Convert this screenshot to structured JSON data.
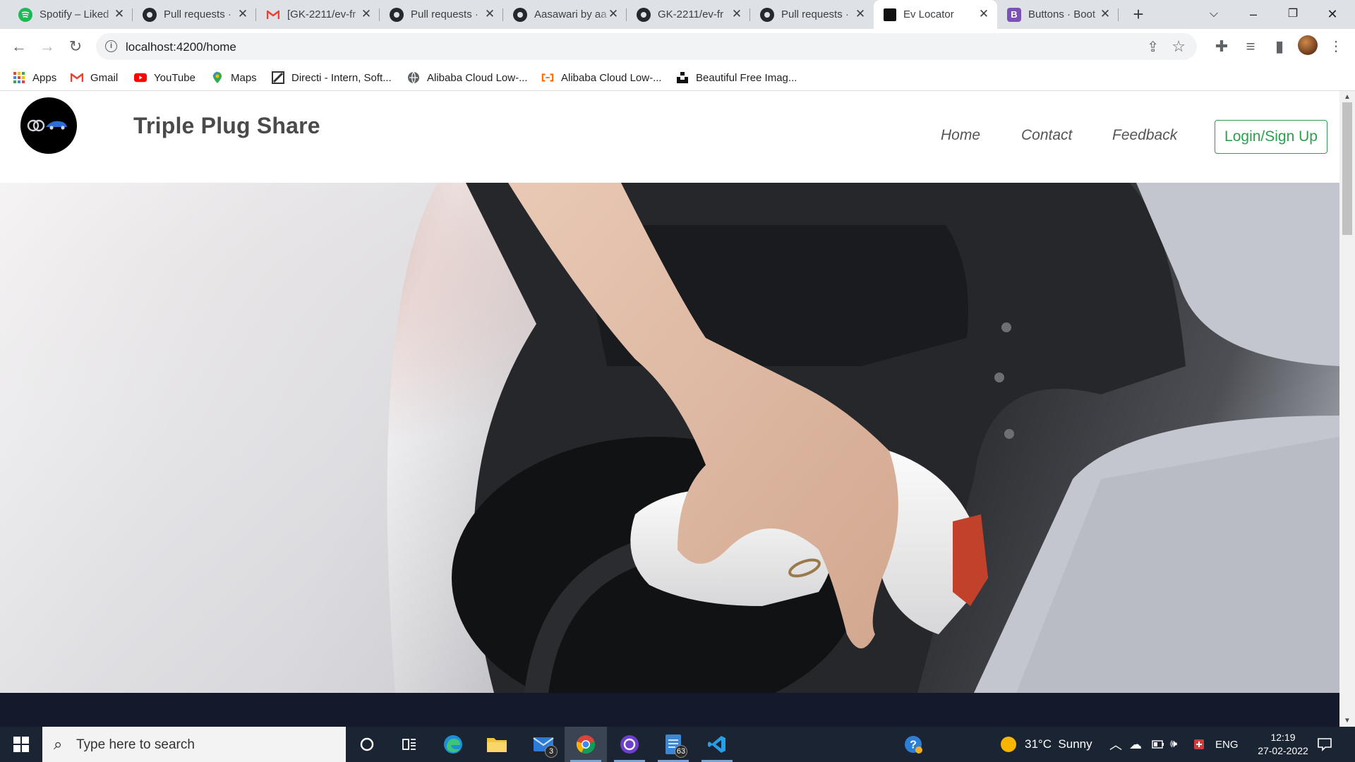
{
  "browser": {
    "tabs": [
      {
        "title": "Spotify – Liked",
        "icon": "spotify-icon",
        "color": "#1db954"
      },
      {
        "title": "Pull requests ·",
        "icon": "github-icon"
      },
      {
        "title": "[GK-2211/ev-fr",
        "icon": "gmail-icon"
      },
      {
        "title": "Pull requests ·",
        "icon": "github-icon"
      },
      {
        "title": "Aasawari by aa",
        "icon": "github-icon"
      },
      {
        "title": "GK-2211/ev-fr",
        "icon": "github-icon"
      },
      {
        "title": "Pull requests ·",
        "icon": "github-icon"
      },
      {
        "title": "Ev Locator",
        "icon": "ev-locator-icon",
        "active": true
      },
      {
        "title": "Buttons · Boot",
        "icon": "bootstrap-icon",
        "color": "#7952b3"
      }
    ],
    "new_tab": "+",
    "url": "localhost:4200/home",
    "bookmarks": [
      {
        "label": "Apps",
        "icon": "apps-grid-icon"
      },
      {
        "label": "Gmail",
        "icon": "gmail-icon"
      },
      {
        "label": "YouTube",
        "icon": "youtube-icon"
      },
      {
        "label": "Maps",
        "icon": "maps-icon"
      },
      {
        "label": "Directi - Intern, Soft...",
        "icon": "directi-icon"
      },
      {
        "label": "Alibaba Cloud Low-...",
        "icon": "alibaba-icon"
      },
      {
        "label": "Alibaba Cloud Low-...",
        "icon": "alibaba-orange-icon"
      },
      {
        "label": "Beautiful Free Imag...",
        "icon": "unsplash-icon"
      }
    ]
  },
  "site": {
    "brand": "Triple Plug Share",
    "logo_text": "TRIPLE PLUG SHARE",
    "nav": [
      "Home",
      "Contact",
      "Feedback"
    ],
    "login_label": "Login/Sign Up",
    "accent": "#2e9e4f"
  },
  "taskbar": {
    "search_placeholder": "Type here to search",
    "mail_badge": "3",
    "notes_badge": "63",
    "weather": "31°C  Sunny",
    "language": "ENG",
    "time": "12:19",
    "date": "27-02-2022"
  }
}
